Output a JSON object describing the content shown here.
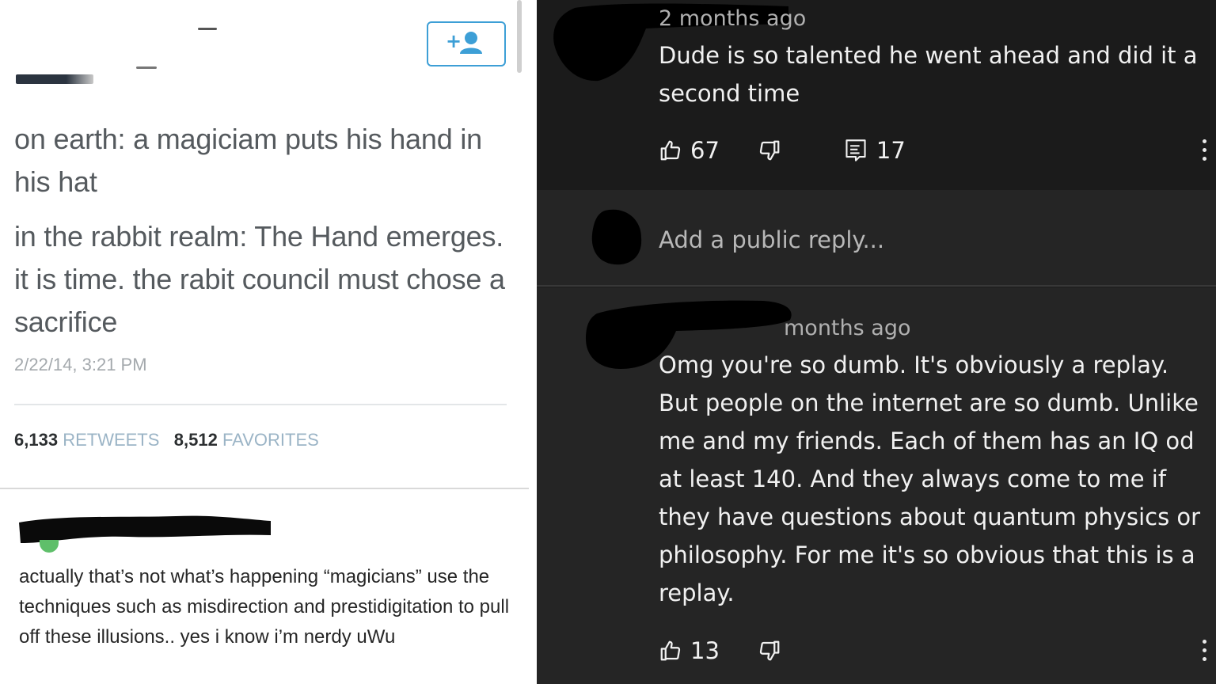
{
  "tweet": {
    "paragraph_1": "on earth: a magiciam puts his hand in his hat",
    "paragraph_2": "in the rabbit realm: The Hand emerges. it is time. the rabit council must chose a sacrifice",
    "timestamp": "2/22/14, 3:21 PM",
    "retweets_count": "6,133",
    "retweets_label": "RETWEETS",
    "favorites_count": "8,512",
    "favorites_label": "FAVORITES",
    "follow_icon": "add-user-icon",
    "colors": {
      "text": "#555a5e",
      "accent": "#3d9fd6",
      "stat_label": "#9bb4c6"
    }
  },
  "tumblr_reply": {
    "text": "actually that’s not what’s happening “magicians” use the techniques such as misdirection and prestidigitation to pull off these illusions.. yes i know i’m nerdy uWu"
  },
  "youtube": {
    "comment_1": {
      "time": "2 months ago",
      "text": "Dude is so talented he went ahead and did it a second time",
      "likes": "67",
      "replies": "17"
    },
    "reply_box": {
      "placeholder": "Add a public reply..."
    },
    "comment_2": {
      "time": "months ago",
      "text": "Omg you're so dumb. It's obviously a replay. But people on the internet are so dumb. Unlike me and my friends. Each of them has an IQ od at least 140. And they always come to me if they have questions about quantum physics or philosophy. For me it's so obvious that this is a replay.",
      "likes": "13"
    },
    "icons": [
      "thumb-up-icon",
      "thumb-down-icon",
      "reply-icon",
      "more-vert-icon"
    ],
    "colors": {
      "background": "#212121",
      "text": "#f1f1f1",
      "meta": "#b0b0b0"
    }
  }
}
